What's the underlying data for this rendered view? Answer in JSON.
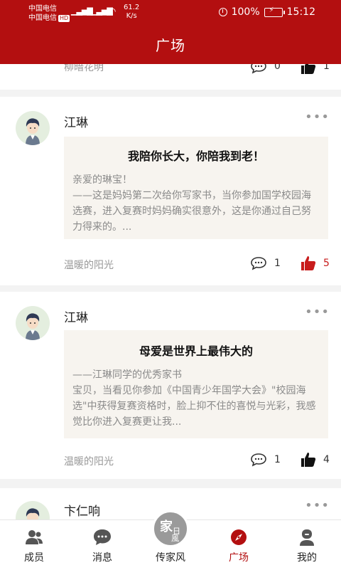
{
  "status_bar": {
    "carrier1": "中国电信",
    "carrier2": "中国电信",
    "hd": "HD",
    "signal": "4G",
    "net_speed_value": "61.2",
    "net_speed_unit": "K/s",
    "battery": "100%",
    "time": "15:12"
  },
  "header": {
    "title": "广场"
  },
  "partial_post": {
    "author": "柳暗花明",
    "comments": "0",
    "likes": "1"
  },
  "posts": [
    {
      "name": "江琳",
      "more": "•••",
      "letter_title": "我陪你长大，你陪我到老！",
      "letter_body": "亲爱的琳宝！\n——这是妈妈第二次给你写家书，当你参加国学校园海选赛，进入复赛时妈妈确实很意外，这是你通过自己努力得来的。...",
      "author": "温暖的阳光",
      "comments": "1",
      "likes": "5",
      "liked": true
    },
    {
      "name": "江琳",
      "more": "•••",
      "letter_title": "母爱是世界上最伟大的",
      "letter_body": "——江琳同学的优秀家书\n宝贝，当看见你参加《中国青少年国学大会》\"校园海选\"中获得复赛资格时，脸上抑不住的喜悦与光彩，我感觉比你进入复赛更让我...",
      "author": "温暖的阳光",
      "comments": "1",
      "likes": "4",
      "liked": false
    },
    {
      "name": "卞仁响",
      "more": "•••"
    }
  ],
  "bottom_nav": {
    "items": [
      {
        "label": "成员",
        "icon": "members-icon"
      },
      {
        "label": "消息",
        "icon": "message-icon"
      },
      {
        "label": "传家风",
        "icon": "family-emblem-icon"
      },
      {
        "label": "广场",
        "icon": "compass-icon",
        "active": true
      },
      {
        "label": "我的",
        "icon": "profile-icon"
      }
    ],
    "emblem_text": [
      "家",
      "風",
      "日"
    ]
  },
  "colors": {
    "brand_red": "#b30f10",
    "like_red": "#c81c1c"
  }
}
